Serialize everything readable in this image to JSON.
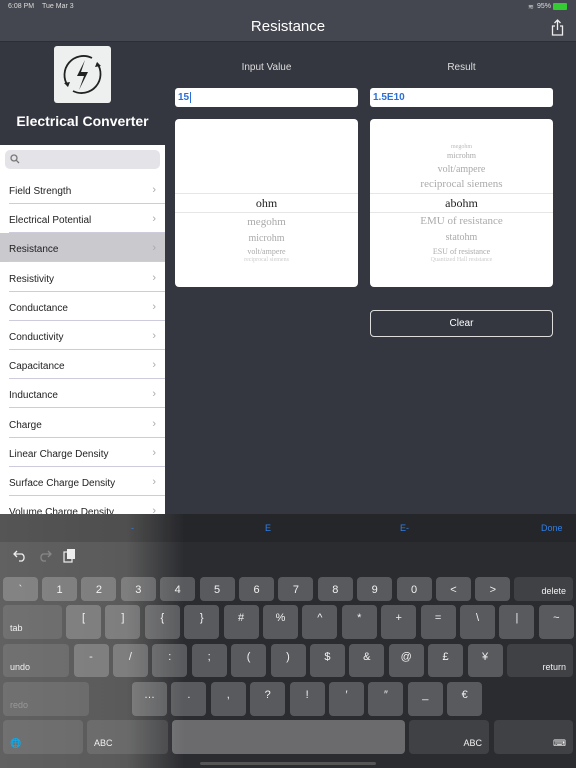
{
  "status": {
    "time": "6:08 PM",
    "date": "Tue Mar 3",
    "battery": "95%"
  },
  "nav": {
    "title": "Resistance",
    "share_icon": "share-icon"
  },
  "sidebar": {
    "app_name": "Electrical Converter",
    "search_placeholder": "",
    "items": [
      {
        "label": "Field Strength"
      },
      {
        "label": "Electrical Potential"
      },
      {
        "label": "Resistance",
        "selected": true
      },
      {
        "label": "Resistivity"
      },
      {
        "label": "Conductance"
      },
      {
        "label": "Conductivity"
      },
      {
        "label": "Capacitance"
      },
      {
        "label": "Inductance"
      },
      {
        "label": "Charge"
      },
      {
        "label": "Linear Charge Density"
      },
      {
        "label": "Surface Charge Density"
      },
      {
        "label": "Volume Charge Density"
      }
    ]
  },
  "main": {
    "input_label": "Input Value",
    "result_label": "Result",
    "input_value": "15",
    "result_value": "1.5E10",
    "input_picker": {
      "selected": "ohm",
      "after": [
        "megohm",
        "microhm",
        "volt/ampere",
        "reciprocal siemens"
      ]
    },
    "result_picker": {
      "before": [
        "megohm",
        "microhm",
        "volt/ampere",
        "reciprocal siemens"
      ],
      "selected": "abohm",
      "after": [
        "EMU of resistance",
        "statohm",
        "ESU of resistance",
        "Quantized Hall resistance"
      ]
    },
    "clear_label": "Clear"
  },
  "accessory": {
    "minus": "-",
    "e": "E",
    "e_minus": "E-",
    "done": "Done",
    "accent": "#2f7fe6"
  },
  "keyboard": {
    "row1": [
      "`",
      "1",
      "2",
      "3",
      "4",
      "5",
      "6",
      "7",
      "8",
      "9",
      "0",
      "<",
      ">"
    ],
    "delete": "delete",
    "row2": [
      "[",
      "]",
      "{",
      "}",
      "#",
      "%",
      "^",
      "*",
      "+",
      "=",
      "\\",
      "|",
      "~"
    ],
    "tab": "tab",
    "row3": [
      "-",
      "/",
      ":",
      ";",
      "(",
      ")",
      "$",
      "&",
      "@",
      "£",
      "¥"
    ],
    "undo": "undo",
    "return": "return",
    "row4": [
      "…",
      ".",
      ",",
      "?",
      "!",
      "′",
      "″",
      "_",
      "€"
    ],
    "redo": "redo",
    "abc": "ABC"
  }
}
